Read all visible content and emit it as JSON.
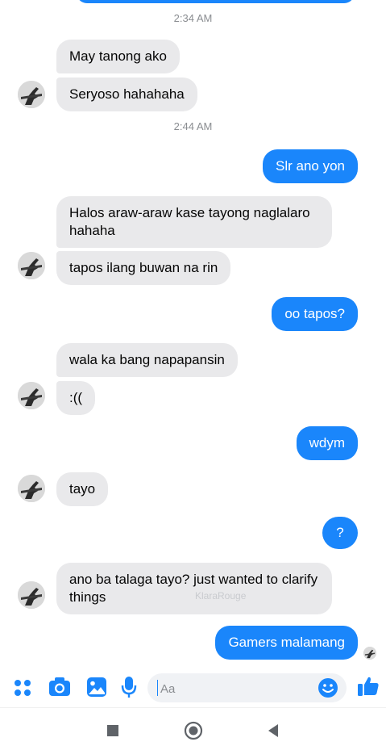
{
  "thread": {
    "timestamps": [
      "2:34 AM",
      "2:44 AM"
    ],
    "messages": [
      {
        "from": "them",
        "text": "May tanong ako"
      },
      {
        "from": "them",
        "text": "Seryoso hahahaha"
      },
      {
        "from": "me",
        "text": "Slr ano yon"
      },
      {
        "from": "them",
        "text": "Halos araw-araw kase tayong naglalaro hahaha"
      },
      {
        "from": "them",
        "text": "tapos ilang buwan na rin"
      },
      {
        "from": "me",
        "text": "oo tapos?"
      },
      {
        "from": "them",
        "text": "wala ka bang napapansin"
      },
      {
        "from": "them",
        "text": ":(("
      },
      {
        "from": "me",
        "text": "wdym"
      },
      {
        "from": "them",
        "text": "tayo"
      },
      {
        "from": "me",
        "text": "?"
      },
      {
        "from": "them",
        "text": "ano ba talaga tayo? just wanted to clarify things"
      },
      {
        "from": "me",
        "text": "Gamers malamang"
      }
    ],
    "watermark": "KlaraRouge"
  },
  "composer": {
    "placeholder": "Aa",
    "icons": [
      "apps-icon",
      "camera-icon",
      "image-icon",
      "microphone-icon",
      "emoji-icon",
      "thumbs-up-icon"
    ]
  },
  "navbar": {
    "icons": [
      "recent-apps-icon",
      "home-icon",
      "back-icon"
    ]
  },
  "colors": {
    "outgoing": "#1a86fb",
    "incoming": "#e9e9eb",
    "accent": "#1a86fb"
  }
}
